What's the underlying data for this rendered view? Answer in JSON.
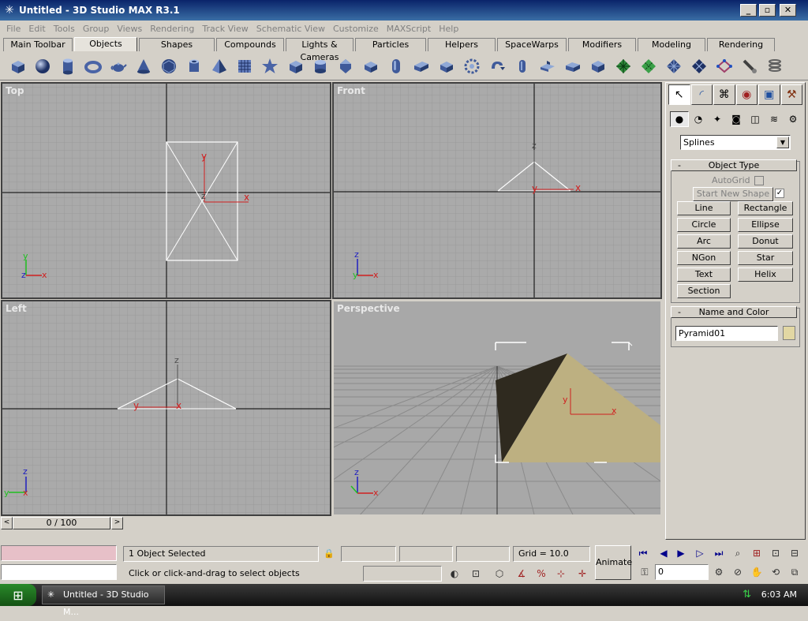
{
  "window": {
    "title": "Untitled - 3D Studio MAX R3.1"
  },
  "menu": [
    "File",
    "Edit",
    "Tools",
    "Group",
    "Views",
    "Rendering",
    "Track View",
    "Schematic View",
    "Customize",
    "MAXScript",
    "Help"
  ],
  "tabs": [
    "Main Toolbar",
    "Objects",
    "Shapes",
    "Compounds",
    "Lights & Cameras",
    "Particles",
    "Helpers",
    "SpaceWarps",
    "Modifiers",
    "Modeling",
    "Rendering"
  ],
  "active_tab": "Objects",
  "toolbar_icons": [
    "box-icon",
    "sphere-icon",
    "cylinder-icon",
    "torus-icon",
    "teapot-icon",
    "cone-icon",
    "geosphere-icon",
    "tube-icon",
    "pyramid-icon",
    "grid-icon",
    "star-icon",
    "chamferbox-icon",
    "oiltank-icon",
    "spindle-icon",
    "gengon-icon",
    "capsule-icon",
    "hedra-icon",
    "ringwave-icon",
    "hose-icon",
    "capsule2-icon",
    "lext-icon",
    "cext-icon",
    "prism-icon",
    "plane-icon",
    "plane2-icon",
    "grid2-icon",
    "grid3-icon",
    "scatter-icon",
    "boolean-icon",
    "spring-icon"
  ],
  "viewports": {
    "top": "Top",
    "front": "Front",
    "left": "Left",
    "perspective": "Perspective"
  },
  "command_panel": {
    "category_value": "Splines",
    "object_type_header": "Object Type",
    "autogrid_label": "AutoGrid",
    "start_new_shape_label": "Start New Shape",
    "start_new_shape_checked": true,
    "buttons": [
      "Line",
      "Rectangle",
      "Circle",
      "Ellipse",
      "Arc",
      "Donut",
      "NGon",
      "Star",
      "Text",
      "Helix",
      "Section"
    ],
    "name_color_header": "Name and Color",
    "object_name": "Pyramid01",
    "object_color": "#e2d7a3"
  },
  "timeline": {
    "frame_display": "0 / 100"
  },
  "status": {
    "selection": "1 Object Selected",
    "prompt": "Click or click-and-drag to select objects",
    "grid": "Grid = 10.0",
    "animate_label": "Animate",
    "frame_value": "0"
  },
  "taskbar": {
    "task_label": "Untitled - 3D Studio M...",
    "clock": "6:03 AM"
  }
}
